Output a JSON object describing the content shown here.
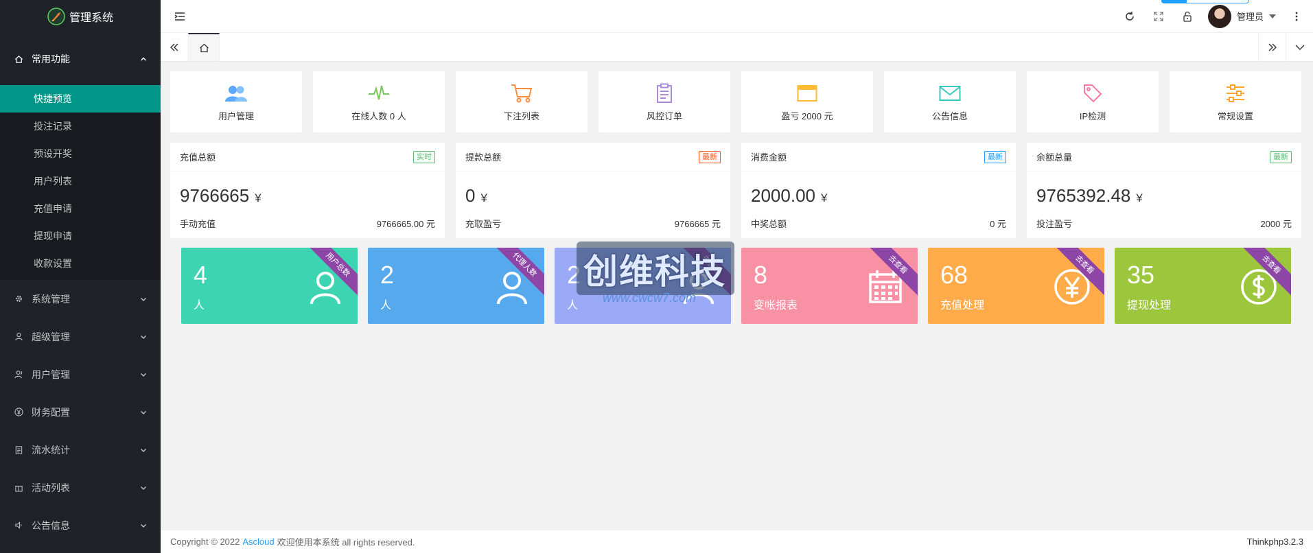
{
  "app": {
    "title": "管理系统"
  },
  "sidebar": {
    "active_group": {
      "label": "常用功能",
      "items": [
        {
          "label": "快捷预览",
          "active": true
        },
        {
          "label": "投注记录"
        },
        {
          "label": "预设开奖"
        },
        {
          "label": "用户列表"
        },
        {
          "label": "充值申请"
        },
        {
          "label": "提现申请"
        },
        {
          "label": "收款设置"
        }
      ]
    },
    "groups": [
      {
        "label": "系统管理",
        "icon": "gear-icon"
      },
      {
        "label": "超级管理",
        "icon": "user-icon"
      },
      {
        "label": "用户管理",
        "icon": "users-icon"
      },
      {
        "label": "财务配置",
        "icon": "yen-icon"
      },
      {
        "label": "流水统计",
        "icon": "clipboard-icon"
      },
      {
        "label": "活动列表",
        "icon": "gift-icon"
      },
      {
        "label": "公告信息",
        "icon": "speaker-icon"
      }
    ]
  },
  "header": {
    "user_name": "管理员",
    "icons": [
      "menu-fold-icon",
      "refresh-icon",
      "fullscreen-icon",
      "lock-icon",
      "more-icon"
    ]
  },
  "quick_links": [
    {
      "label": "用户管理",
      "icon": "users-icon",
      "color": "#5ca8ff"
    },
    {
      "label": "在线人数 0 人",
      "icon": "pulse-icon",
      "color": "#7bc65a"
    },
    {
      "label": "下注列表",
      "icon": "cart-icon",
      "color": "#ff8b3d"
    },
    {
      "label": "风控订单",
      "icon": "clipboard-icon",
      "color": "#a98bd9"
    },
    {
      "label": "盈亏 2000 元",
      "icon": "card-icon",
      "color": "#ffbb33"
    },
    {
      "label": "公告信息",
      "icon": "mail-icon",
      "color": "#3cc7c0"
    },
    {
      "label": "IP检测",
      "icon": "tag-icon",
      "color": "#ff7aa0"
    },
    {
      "label": "常规设置",
      "icon": "sliders-icon",
      "color": "#ffa534"
    }
  ],
  "stats": [
    {
      "title": "充值总额",
      "badge": "实时",
      "badge_color": "green",
      "value": "9766665",
      "unit": "¥",
      "foot_label": "手动充值",
      "foot_value": "9766665.00 元"
    },
    {
      "title": "提款总额",
      "badge": "最新",
      "badge_color": "red",
      "value": "0",
      "unit": "¥",
      "foot_label": "充取盈亏",
      "foot_value": "9766665 元"
    },
    {
      "title": "消费金额",
      "badge": "最新",
      "badge_color": "blue",
      "value": "2000.00",
      "unit": "¥",
      "foot_label": "中奖总额",
      "foot_value": "0 元"
    },
    {
      "title": "余额总量",
      "badge": "最新",
      "badge_color": "green",
      "value": "9765392.48",
      "unit": "¥",
      "foot_label": "投注盈亏",
      "foot_value": "2000 元"
    }
  ],
  "color_cards": [
    {
      "number": "4",
      "label": "人",
      "ribbon": "用户总数",
      "bg": "#3dd5b1",
      "icon": "user-icon"
    },
    {
      "number": "2",
      "label": "人",
      "ribbon": "代理人数",
      "bg": "#56a9ec",
      "icon": "user-icon"
    },
    {
      "number": "2",
      "label": "人",
      "ribbon": "去查看",
      "bg": "#9aaaf7",
      "icon": "user-icon"
    },
    {
      "number": "8",
      "label": "变帐报表",
      "ribbon": "去查看",
      "bg": "#f891a3",
      "icon": "calendar-icon"
    },
    {
      "number": "68",
      "label": "充值处理",
      "ribbon": "去查看",
      "bg": "#ffab4a",
      "icon": "yen-circle-icon"
    },
    {
      "number": "35",
      "label": "提现处理",
      "ribbon": "去查看",
      "bg": "#9cc63b",
      "icon": "dollar-circle-icon"
    }
  ],
  "watermark": {
    "text": "创维科技",
    "url": "www.cwcw7.com"
  },
  "footer": {
    "copyright_prefix": "Copyright © 2022",
    "link_text": "Ascloud",
    "copyright_suffix": "欢迎使用本系统 all rights reserved.",
    "version": "Thinkphp3.2.3"
  }
}
